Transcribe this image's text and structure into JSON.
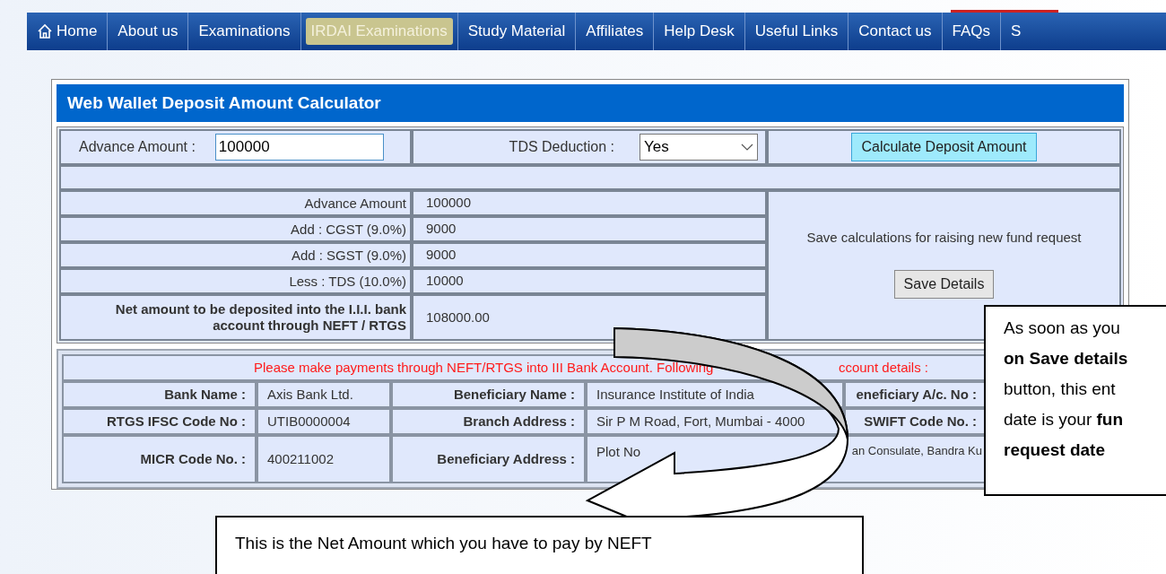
{
  "nav": {
    "items": [
      {
        "label": "Home",
        "kind": "home",
        "selected": false
      },
      {
        "label": "About us",
        "kind": "link",
        "selected": false
      },
      {
        "label": "Examinations",
        "kind": "link",
        "selected": false
      },
      {
        "label": "IRDAI Examinations",
        "kind": "link",
        "selected": true
      },
      {
        "label": "Study Material",
        "kind": "link",
        "selected": false
      },
      {
        "label": "Affiliates",
        "kind": "link",
        "selected": false
      },
      {
        "label": "Help Desk",
        "kind": "link",
        "selected": false
      },
      {
        "label": "Useful Links",
        "kind": "link",
        "selected": false
      },
      {
        "label": "Contact us",
        "kind": "link",
        "selected": false
      },
      {
        "label": "FAQs",
        "kind": "link",
        "selected": false
      },
      {
        "label": "S",
        "kind": "link",
        "selected": false
      }
    ]
  },
  "calculator": {
    "title": "Web Wallet Deposit Amount Calculator",
    "advance_label": "Advance Amount :",
    "advance_value": "100000",
    "tds_label": "TDS Deduction :",
    "tds_value": "Yes",
    "calculate_button": "Calculate Deposit Amount",
    "breakdown": [
      {
        "label": "Advance Amount",
        "value": "100000",
        "kind": "line"
      },
      {
        "label": "Add : CGST (9.0%)",
        "value": "9000",
        "kind": "line"
      },
      {
        "label": "Add : SGST (9.0%)",
        "value": "9000",
        "kind": "line"
      },
      {
        "label": "Less : TDS (10.0%)",
        "value": "10000",
        "kind": "line"
      },
      {
        "label": "Net amount to be deposited into the I.I.I. bank account through NEFT / RTGS",
        "value": "108000.00",
        "kind": "total"
      }
    ],
    "save_note": "Save calculations for raising new fund request",
    "save_button": "Save Details"
  },
  "bank": {
    "notice": [
      "Please make payments through NEFT/RTGS into III Bank Account. Following",
      "ccount details :"
    ],
    "rows": [
      {
        "cells": [
          "Bank Name :",
          "Axis Bank Ltd.",
          "Beneficiary Name :",
          "Insurance Institute of India",
          "eneficiary A/c. No :"
        ]
      },
      {
        "cells": [
          "RTGS IFSC Code No :",
          "UTIB0000004",
          "Branch Address :",
          "Sir P M Road, Fort, Mumbai - 4000",
          "SWIFT Code No. :"
        ]
      },
      {
        "cells": [
          "MICR Code No. :",
          "400211002",
          "Beneficiary Address :",
          "Plot No",
          "an Consulate, Bandra Ku"
        ]
      }
    ]
  },
  "callouts": {
    "bottom": "This is the Net Amount which you have to pay by NEFT",
    "right": [
      {
        "text": "As soon as you",
        "bold": false
      },
      {
        "text": "on Save details",
        "bold": true
      },
      {
        "text": "button, this ent",
        "bold": false
      },
      {
        "text": "date is your **fun**",
        "bold": false
      },
      {
        "text": "request date",
        "bold": true
      }
    ]
  }
}
